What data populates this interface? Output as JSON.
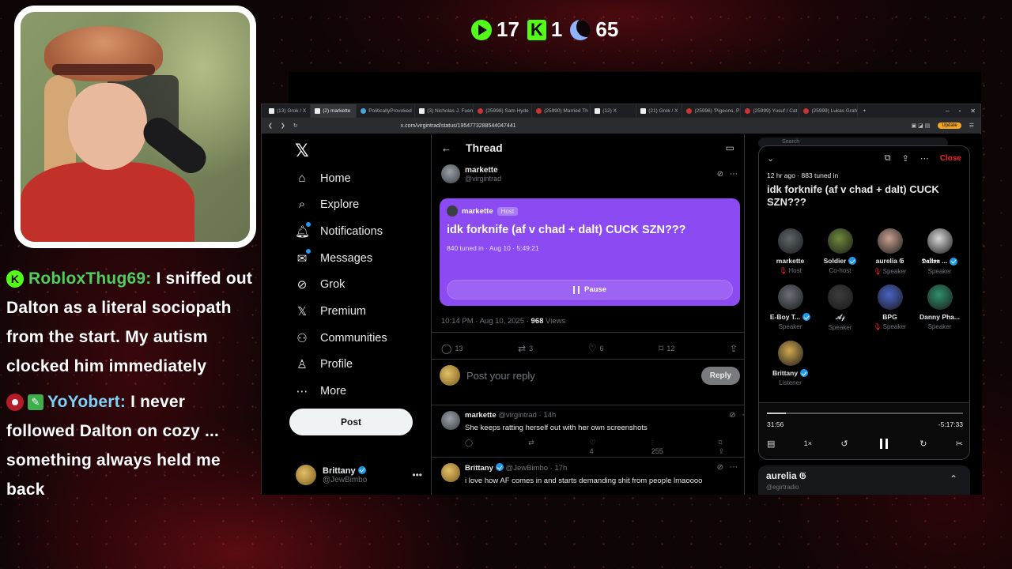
{
  "overlay": {
    "counters": [
      {
        "icon": "play-icon",
        "value": "17"
      },
      {
        "icon": "kick-icon",
        "value": "1"
      },
      {
        "icon": "moon-icon",
        "value": "65"
      }
    ],
    "chat": [
      {
        "badges": [
          "kick-badge"
        ],
        "username": "RobloxThug69:",
        "text": "I sniffed out Dalton as a literal sociopath from the start. My autism clocked him immediately"
      },
      {
        "badges": [
          "record-badge",
          "pen-badge"
        ],
        "username": "YoYobert:",
        "text": "I never followed Dalton on cozy ... something always held me back"
      }
    ]
  },
  "browser": {
    "tabs": [
      "(13) Grok / X",
      "(2) markette",
      "PoliticallyProvoked",
      "(3) Nicholas J. Fuen",
      "(25998) Sam Hyde",
      "(25990) Married Th",
      "(12) X",
      "(21) Grok / X",
      "(25996) 'Pigeons, P",
      "(25999) Yusuf / Cat",
      "(25999) Lukas Grah"
    ],
    "url": "x.com/virgintrad/status/1954773288544047441",
    "update_label": "Update"
  },
  "nav": {
    "items": [
      {
        "icon": "home-icon",
        "label": "Home"
      },
      {
        "icon": "search-icon",
        "label": "Explore"
      },
      {
        "icon": "bell-icon",
        "label": "Notifications"
      },
      {
        "icon": "mail-icon",
        "label": "Messages"
      },
      {
        "icon": "grok-icon",
        "label": "Grok"
      },
      {
        "icon": "x-icon",
        "label": "Premium"
      },
      {
        "icon": "people-icon",
        "label": "Communities"
      },
      {
        "icon": "person-icon",
        "label": "Profile"
      },
      {
        "icon": "more-icon",
        "label": "More"
      }
    ],
    "post_label": "Post",
    "account": {
      "name": "Brittany",
      "handle": "@JewBimbo"
    }
  },
  "thread": {
    "title": "Thread",
    "author": {
      "name": "markette",
      "handle": "@virgintrad"
    },
    "space": {
      "host_name": "markette",
      "host_badge": "Host",
      "title": "idk forknife (af v chad + dalt) CUCK SZN???",
      "meta": "840 tuned in · Aug 10 · 5:49:21",
      "pause_label": "Pause"
    },
    "timestamp": "10:14 PM · Aug 10, 2025 · ",
    "views_count": "968",
    "views_label": " Views",
    "stats": {
      "replies": "13",
      "reposts": "3",
      "likes": "6",
      "bookmarks": "12"
    },
    "reply_placeholder": "Post your reply",
    "reply_button": "Reply",
    "replies": [
      {
        "name": "markette",
        "handle": "@virgintrad · 14h",
        "text": "She keeps ratting herself out with her own screenshots",
        "likes": "4",
        "views": "255"
      },
      {
        "name": "Brittany",
        "handle": "@JewBimbo · 17h",
        "text": "i love how AF comes in and starts demanding shit from people lmaoooo"
      }
    ]
  },
  "space_panel": {
    "search_placeholder": "Search",
    "close_label": "Close",
    "meta": "12 hr ago · 883 tuned in",
    "title": "idk forknife (af v chad + dalt) CUCK SZN???",
    "participants": [
      {
        "name": "markette",
        "role": "Host",
        "muted": true,
        "color": "#5f6569"
      },
      {
        "name": "Soldier",
        "role": "Co-host",
        "muted": false,
        "verified": true,
        "color": "#6f8a3a"
      },
      {
        "name": "aurelia 𝔊",
        "role": "Speaker",
        "muted": true,
        "color": "#c8a090"
      },
      {
        "name": "𝕯𝖆𝖑𝖙𝖔𝖓 ...",
        "role": "Speaker",
        "muted": false,
        "verified": true,
        "color": "#d8d8d8"
      },
      {
        "name": "E-Boy T...",
        "role": "Speaker",
        "muted": false,
        "verified": true,
        "color": "#6a7078"
      },
      {
        "name": "𝒜𝒻",
        "role": "Speaker",
        "muted": false,
        "color": "#3c3c3c"
      },
      {
        "name": "BPG",
        "role": "Speaker",
        "muted": true,
        "color": "#4a63c8"
      },
      {
        "name": "Danny Pha...",
        "role": "Speaker",
        "muted": false,
        "color": "#2f8f6a"
      },
      {
        "name": "Brittany",
        "role": "Listener",
        "muted": false,
        "verified": true,
        "color": "#d1a84f"
      }
    ],
    "progress": 0.095,
    "elapsed": "31:56",
    "remaining": "-5:17:33",
    "speed": "1×",
    "host_card": {
      "name": "aurelia 𝔊",
      "handle": "@egirtradio"
    }
  },
  "colors": {
    "space_purple": "#8c4bf2",
    "kick_green": "#53fc18",
    "x_blue": "#1d9bf0",
    "close_red": "#f4212e"
  }
}
